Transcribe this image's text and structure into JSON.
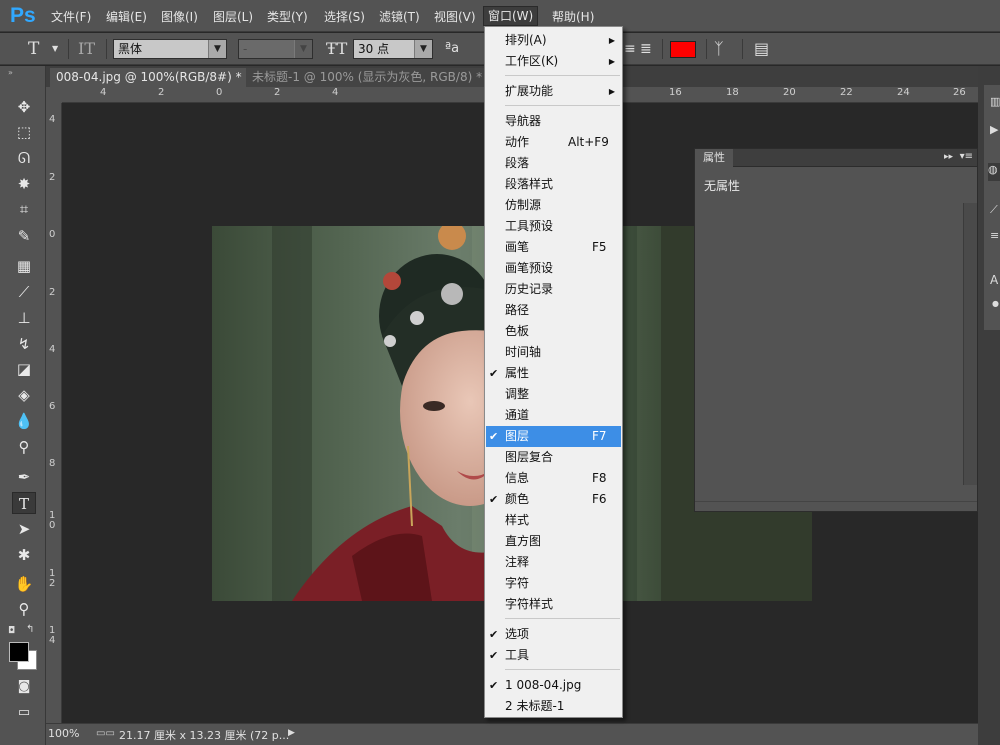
{
  "app": {
    "logo": "Ps"
  },
  "menubar": {
    "items": [
      "文件(F)",
      "编辑(E)",
      "图像(I)",
      "图层(L)",
      "类型(Y)",
      "选择(S)",
      "滤镜(T)",
      "视图(V)",
      "窗口(W)",
      "帮助(H)"
    ]
  },
  "options": {
    "font_family": "黑体",
    "font_style": "-",
    "font_size": "30 点",
    "aa_label": "a",
    "text_color": "#ff0000"
  },
  "tabs": [
    {
      "label": "008-04.jpg @ 100%(RGB/8#) *",
      "close": "×"
    },
    {
      "label": "未标题-1 @ 100% (显示为灰色, RGB/8) *",
      "close": "×"
    }
  ],
  "ruler": {
    "top": [
      "4",
      "2",
      "0",
      "2",
      "4",
      "16",
      "18",
      "20",
      "22",
      "24",
      "26"
    ],
    "left": [
      "4",
      "2",
      "0",
      "2",
      "4",
      "6",
      "8",
      "1 0",
      "1 2",
      "1 4"
    ]
  },
  "status": {
    "zoom": "100%",
    "info": "21.17 厘米 x 13.23 厘米 (72 p...",
    "arrow": "▶"
  },
  "properties": {
    "tab": "属性",
    "content": "无属性"
  },
  "window_menu": {
    "groups": [
      [
        {
          "label": "排列(A)",
          "submenu": true
        },
        {
          "label": "工作区(K)",
          "submenu": true
        }
      ],
      [
        {
          "label": "扩展功能",
          "submenu": true
        }
      ],
      [
        {
          "label": "导航器"
        },
        {
          "label": "动作",
          "shortcut": "Alt+F9"
        },
        {
          "label": "段落"
        },
        {
          "label": "段落样式"
        },
        {
          "label": "仿制源"
        },
        {
          "label": "工具预设"
        },
        {
          "label": "画笔",
          "shortcut": "F5"
        },
        {
          "label": "画笔预设"
        },
        {
          "label": "历史记录"
        },
        {
          "label": "路径"
        },
        {
          "label": "色板"
        },
        {
          "label": "时间轴"
        },
        {
          "label": "属性",
          "checked": true
        },
        {
          "label": "调整"
        },
        {
          "label": "通道"
        },
        {
          "label": "图层",
          "shortcut": "F7",
          "checked": true,
          "highlighted": true
        },
        {
          "label": "图层复合"
        },
        {
          "label": "信息",
          "shortcut": "F8"
        },
        {
          "label": "颜色",
          "shortcut": "F6",
          "checked": true
        },
        {
          "label": "样式"
        },
        {
          "label": "直方图"
        },
        {
          "label": "注释"
        },
        {
          "label": "字符"
        },
        {
          "label": "字符样式"
        }
      ],
      [
        {
          "label": "选项",
          "checked": true
        },
        {
          "label": "工具",
          "checked": true
        }
      ],
      [
        {
          "label": "1 008-04.jpg",
          "checked": true
        },
        {
          "label": "2 未标题-1"
        }
      ]
    ]
  }
}
